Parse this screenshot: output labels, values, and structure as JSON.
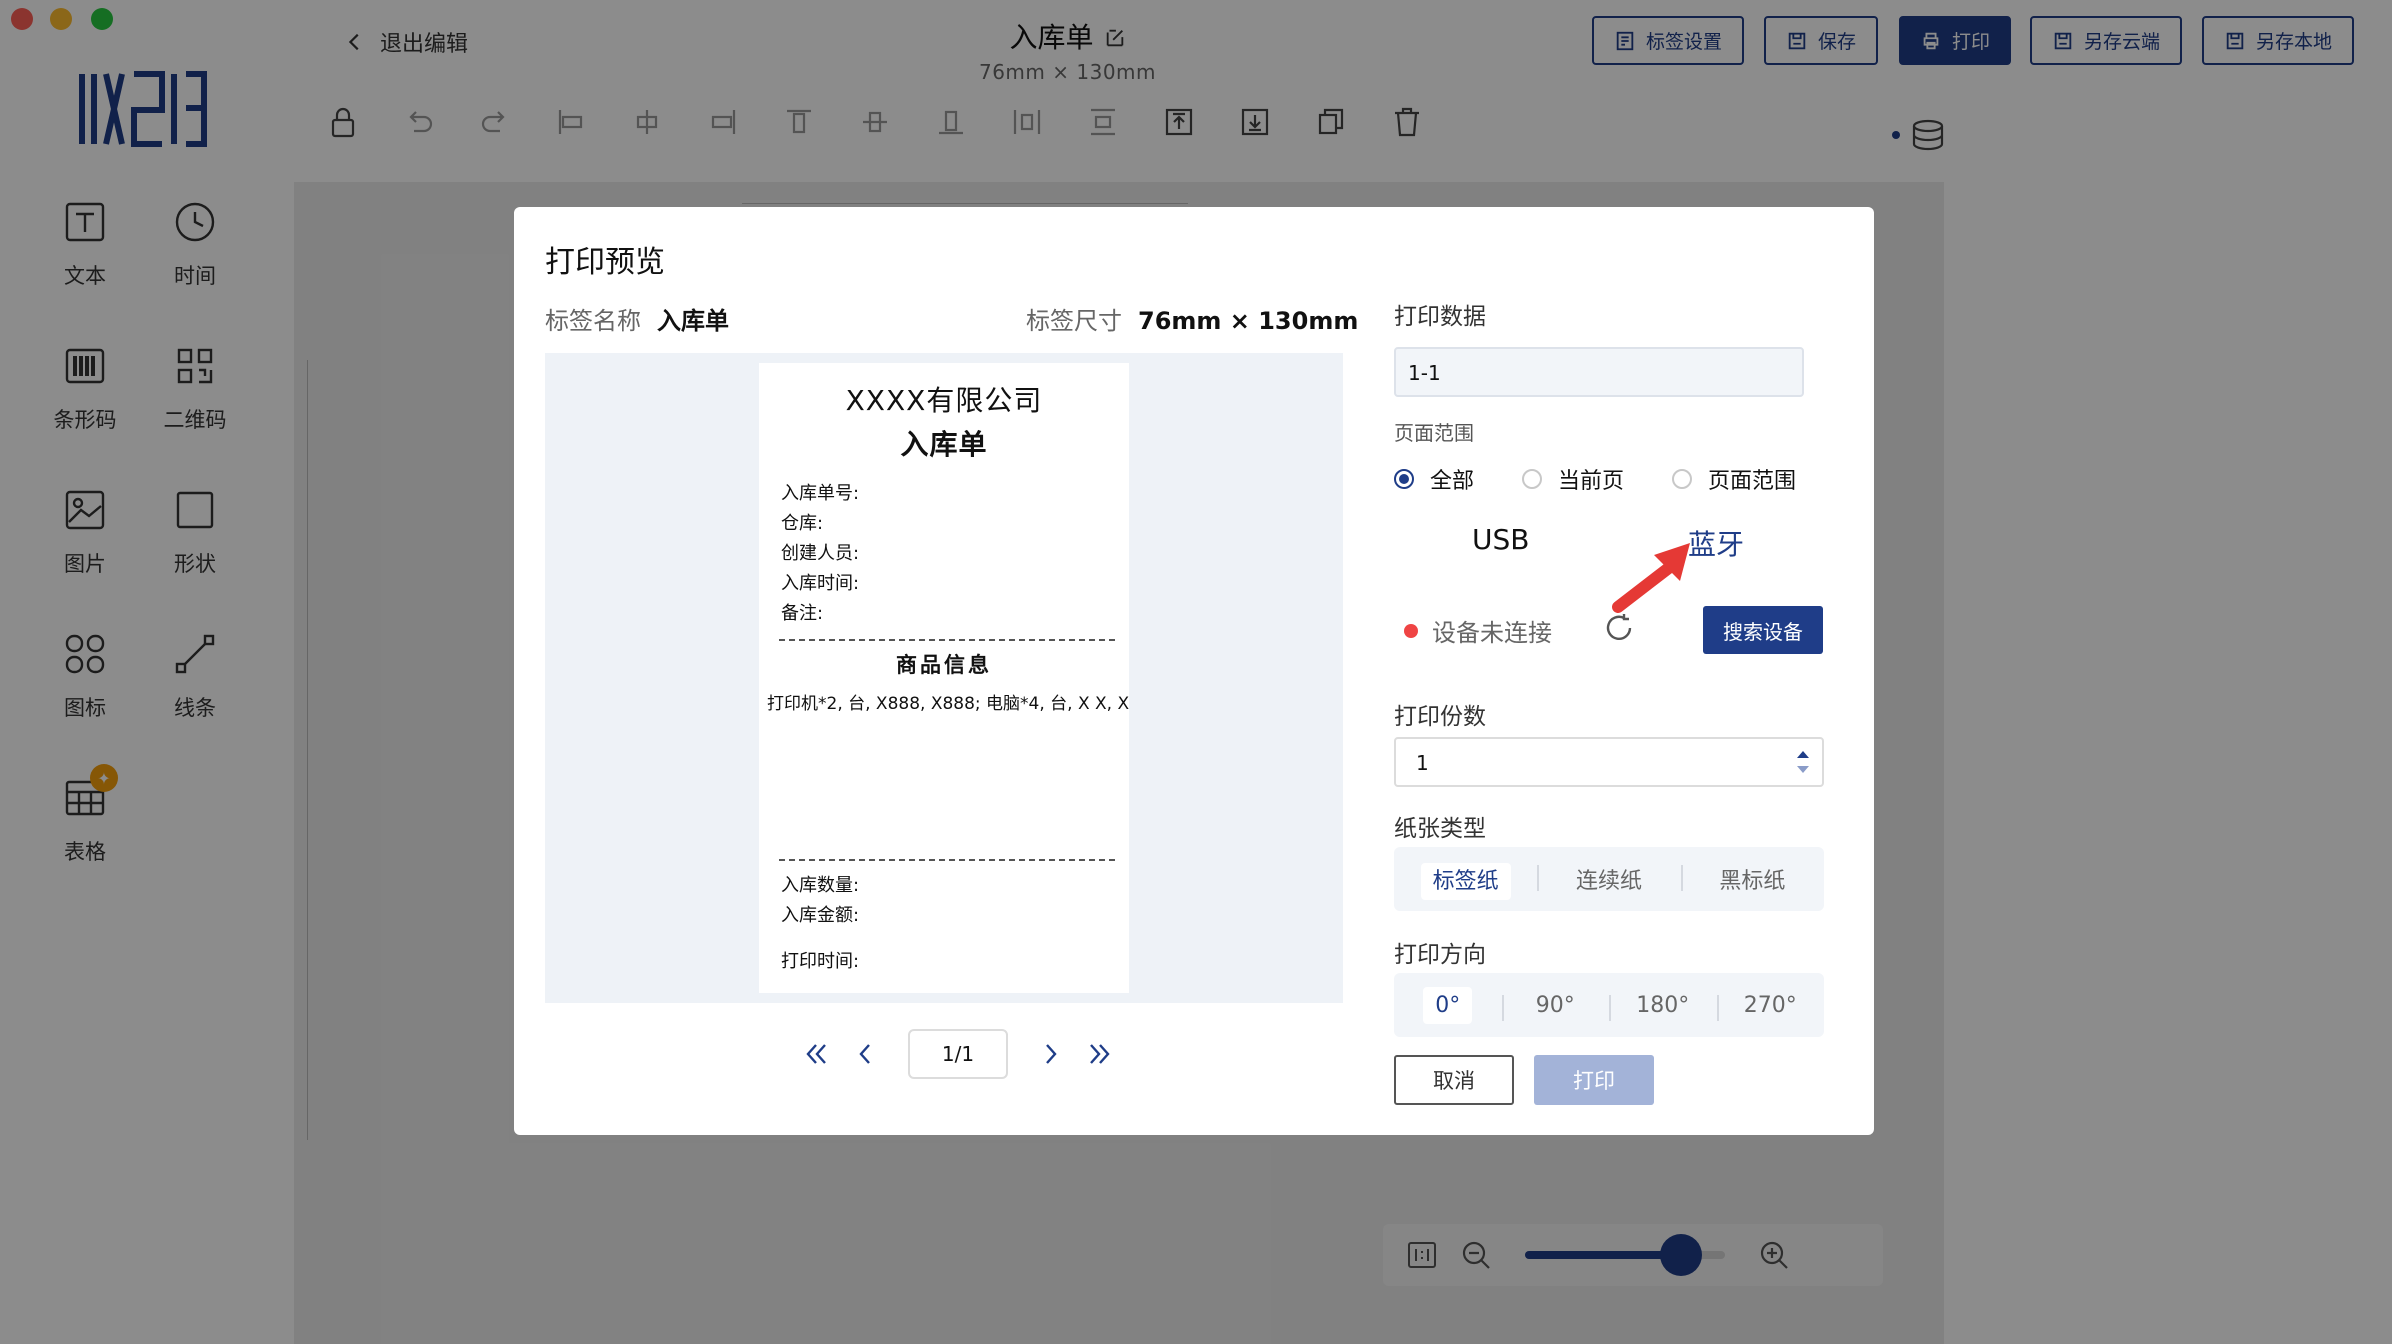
{
  "colors": {
    "accent": "#1f3d88",
    "disabled_primary": "#a3b3d8",
    "status_error": "#ef4444",
    "annotation_arrow": "#e53935"
  },
  "window": {
    "traffic_lights": [
      "close",
      "minimize",
      "maximize"
    ]
  },
  "header": {
    "back_label": "退出编辑",
    "doc_title": "入库单",
    "doc_size": "76mm × 130mm",
    "buttons": {
      "label_settings": "标签设置",
      "save": "保存",
      "print": "打印",
      "save_cloud": "另存云端",
      "save_local": "另存本地"
    }
  },
  "toolbar": {
    "icons": [
      "lock-icon",
      "undo-icon",
      "redo-icon",
      "align-left-icon",
      "align-center-h-icon",
      "align-right-icon",
      "align-top-icon",
      "align-middle-v-icon",
      "align-bottom-icon",
      "distribute-h-icon",
      "distribute-v-icon",
      "bring-front-icon",
      "send-back-icon",
      "copy-icon",
      "delete-icon"
    ]
  },
  "sidebar": {
    "items": [
      {
        "label": "文本",
        "icon": "text-icon"
      },
      {
        "label": "时间",
        "icon": "clock-icon"
      },
      {
        "label": "条形码",
        "icon": "barcode-icon"
      },
      {
        "label": "二维码",
        "icon": "qrcode-icon"
      },
      {
        "label": "图片",
        "icon": "image-icon"
      },
      {
        "label": "形状",
        "icon": "shape-icon"
      },
      {
        "label": "图标",
        "icon": "icons-icon"
      },
      {
        "label": "线条",
        "icon": "line-icon"
      },
      {
        "label": "表格",
        "icon": "table-icon"
      }
    ]
  },
  "zoom": {
    "level": 0.78
  },
  "dialog": {
    "title": "打印预览",
    "label_name_key": "标签名称",
    "label_name_value": "入库单",
    "label_size_key": "标签尺寸",
    "label_size_value": "76mm × 130mm",
    "preview": {
      "company": "XXXX有限公司",
      "title": "入库单",
      "fields": [
        "入库单号:",
        "仓库:",
        "创建人员:",
        "入库时间:",
        "备注:"
      ],
      "section": "商品信息",
      "goods": "打印机*2, 台, X888, X888; 电脑*4, 台, X X, X",
      "footer_fields": [
        "入库数量:",
        "入库金额:"
      ],
      "print_time": "打印时间:"
    },
    "pager": {
      "value": "1/1"
    },
    "print_data_label": "打印数据",
    "print_data_value": "1-1",
    "page_range_label": "页面范围",
    "page_range_options": [
      "全部",
      "当前页",
      "页面范围"
    ],
    "page_range_selected": "全部",
    "connection": {
      "usb": "USB",
      "bluetooth": "蓝牙"
    },
    "device_status": "设备未连接",
    "search_device": "搜索设备",
    "copies_label": "打印份数",
    "copies_value": "1",
    "paper_type_label": "纸张类型",
    "paper_types": [
      "标签纸",
      "连续纸",
      "黑标纸"
    ],
    "paper_type_selected": "标签纸",
    "direction_label": "打印方向",
    "directions": [
      "0°",
      "90°",
      "180°",
      "270°"
    ],
    "direction_selected": "0°",
    "cancel": "取消",
    "print": "打印"
  }
}
